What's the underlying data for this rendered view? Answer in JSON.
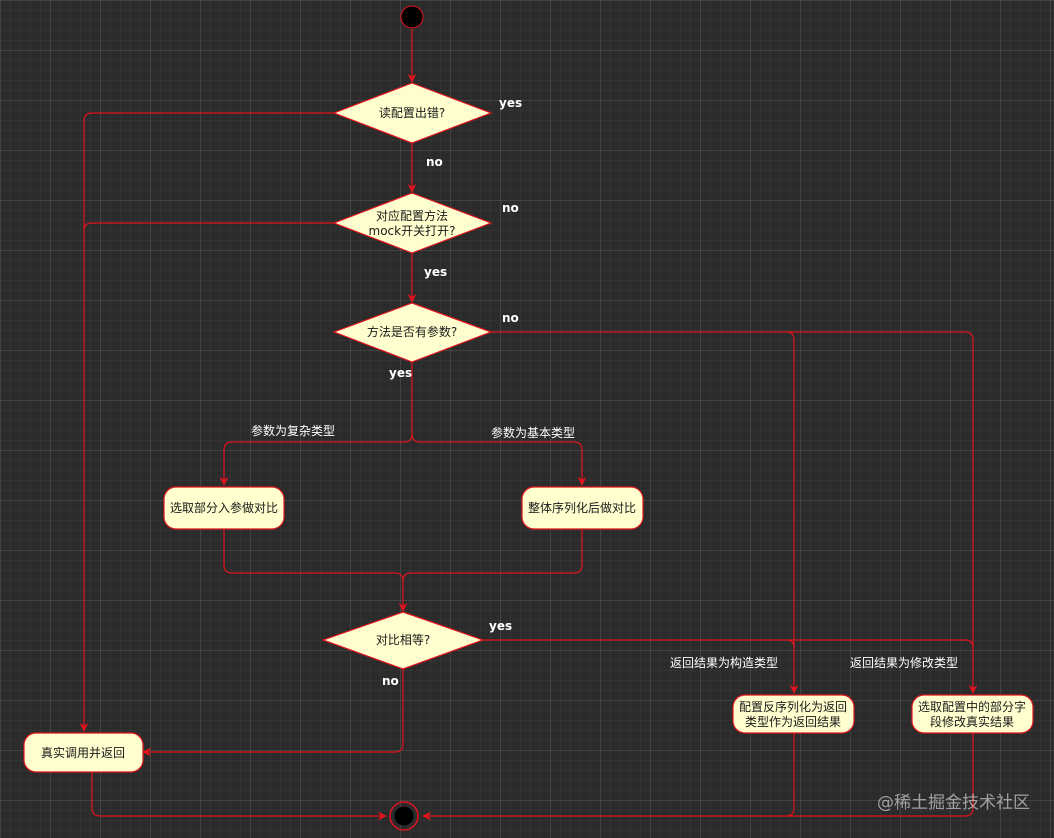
{
  "colors": {
    "stroke": "#e0141e",
    "fill": "#fefece",
    "edge_label": "#ffffff",
    "background": "#2b2b2b"
  },
  "decisions": {
    "d1": "读配置出错?",
    "d2_line1": "对应配置方法",
    "d2_line2": "mock开关打开?",
    "d3": "方法是否有参数?",
    "d4": "对比相等?"
  },
  "actions": {
    "partial_compare": "选取部分入参做对比",
    "full_compare": "整体序列化后做对比",
    "real_call": "真实调用并返回",
    "deserialize_line1": "配置反序列化为返回",
    "deserialize_line2": "类型作为返回结果",
    "modify_line1": "选取配置中的部分字",
    "modify_line2": "段修改真实结果"
  },
  "edge_labels": {
    "d1_yes": "yes",
    "d1_no": "no",
    "d2_no": "no",
    "d2_yes": "yes",
    "d3_no": "no",
    "d3_yes": "yes",
    "complex_param": "参数为复杂类型",
    "basic_param": "参数为基本类型",
    "d4_yes": "yes",
    "d4_no": "no",
    "construct_type": "返回结果为构造类型",
    "modify_type": "返回结果为修改类型"
  },
  "watermark": "@稀土掘金技术社区"
}
